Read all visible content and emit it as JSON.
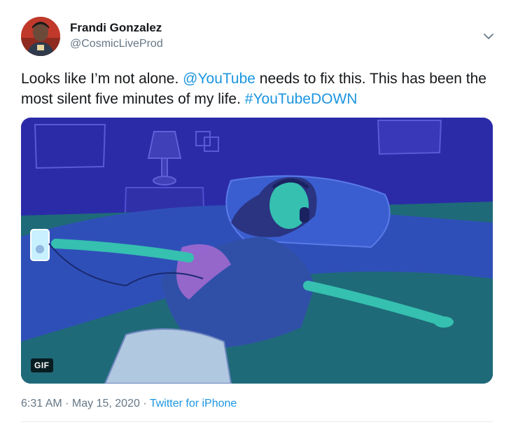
{
  "author": {
    "name": "Frandi Gonzalez",
    "handle": "@CosmicLiveProd"
  },
  "tweet": {
    "text_part1": "Looks like I’m not alone. ",
    "mention": "@YouTube",
    "text_part2": " needs to fix this. This has been the most silent five minutes of my life. ",
    "hashtag": "#YouTubeDOWN"
  },
  "media": {
    "badge": "GIF"
  },
  "meta": {
    "time": "6:31 AM",
    "separator1": " · ",
    "date": "May 15, 2020",
    "separator2": " · ",
    "source": "Twitter for iPhone"
  },
  "icons": {
    "menu": "chevron-down-icon"
  },
  "colors": {
    "link": "#1b95e0",
    "secondary_text": "#657786",
    "primary_text": "#14171a"
  }
}
